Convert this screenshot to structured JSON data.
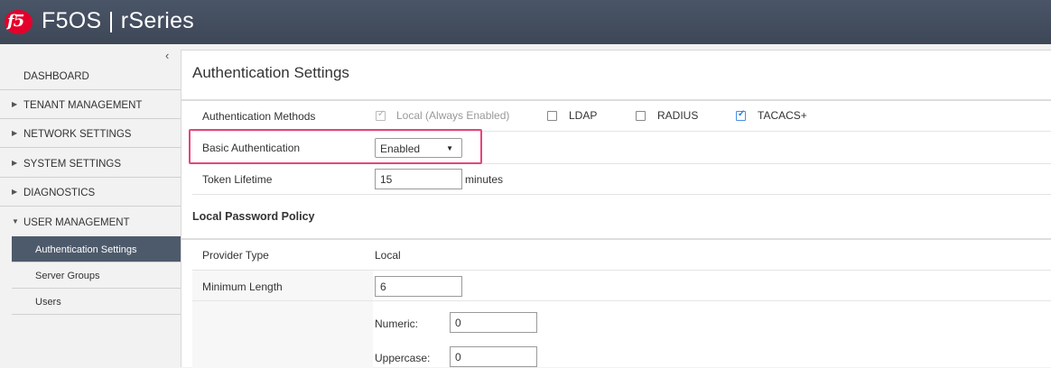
{
  "header": {
    "logo_text": "f5",
    "title": "F5OS | rSeries"
  },
  "sidebar": {
    "collapse_glyph": "‹",
    "items": [
      {
        "label": "DASHBOARD",
        "caret": ""
      },
      {
        "label": "TENANT MANAGEMENT",
        "caret": "▶"
      },
      {
        "label": "NETWORK SETTINGS",
        "caret": "▶"
      },
      {
        "label": "SYSTEM SETTINGS",
        "caret": "▶"
      },
      {
        "label": "DIAGNOSTICS",
        "caret": "▶"
      },
      {
        "label": "USER MANAGEMENT",
        "caret": "▼"
      }
    ],
    "sub_items": [
      {
        "label": "Authentication Settings",
        "active": true
      },
      {
        "label": "Server Groups",
        "active": false
      },
      {
        "label": "Users",
        "active": false
      }
    ]
  },
  "main": {
    "page_title": "Authentication Settings",
    "auth_methods": {
      "label": "Authentication Methods",
      "options": [
        {
          "label": "Local (Always Enabled)",
          "checked": true,
          "disabled": true
        },
        {
          "label": "LDAP",
          "checked": false,
          "disabled": false
        },
        {
          "label": "RADIUS",
          "checked": false,
          "disabled": false
        },
        {
          "label": "TACACS+",
          "checked": true,
          "disabled": false
        }
      ]
    },
    "basic_auth": {
      "label": "Basic Authentication",
      "value": "Enabled",
      "arrow": "▼"
    },
    "token_lifetime": {
      "label": "Token Lifetime",
      "value": "15",
      "unit": "minutes"
    },
    "local_password_policy": {
      "heading": "Local Password Policy",
      "provider_type": {
        "label": "Provider Type",
        "value": "Local"
      },
      "minimum_length": {
        "label": "Minimum Length",
        "value": "6"
      },
      "numeric": {
        "label": "Numeric:",
        "value": "0"
      },
      "uppercase": {
        "label": "Uppercase:",
        "value": "0"
      }
    }
  },
  "colors": {
    "header": "#3d4756",
    "active_nav": "#4d5a6b",
    "logo": "#e4002b",
    "highlight": "#e6457a",
    "checkbox_accent": "#4a90e2"
  }
}
